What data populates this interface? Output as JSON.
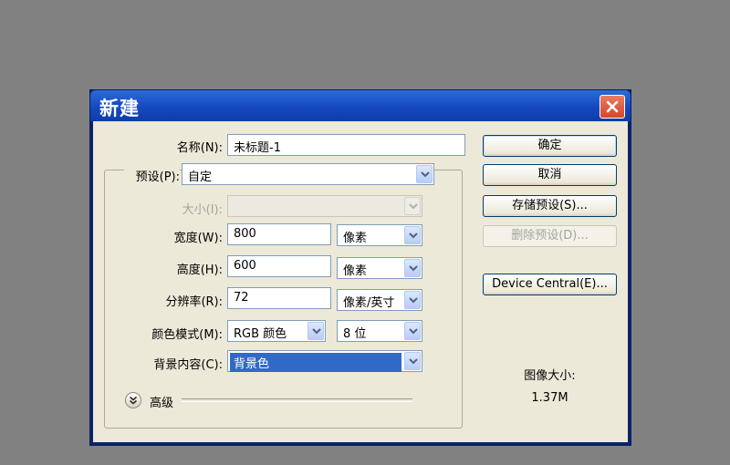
{
  "dialog": {
    "title": "新建",
    "close_icon": "close-icon"
  },
  "form": {
    "name_label": "名称(N):",
    "name_value": "未标题-1",
    "preset_label": "预设(P):",
    "preset_value": "自定",
    "size_label": "大小(I):",
    "size_value": "",
    "width_label": "宽度(W):",
    "width_value": "800",
    "width_unit": "像素",
    "height_label": "高度(H):",
    "height_value": "600",
    "height_unit": "像素",
    "resolution_label": "分辨率(R):",
    "resolution_value": "72",
    "resolution_unit": "像素/英寸",
    "color_mode_label": "颜色模式(M):",
    "color_mode_value": "RGB 颜色",
    "bit_depth_value": "8 位",
    "background_label": "背景内容(C):",
    "background_value": "背景色",
    "advanced_label": "高级"
  },
  "buttons": {
    "ok": "确定",
    "cancel": "取消",
    "save_preset": "存储预设(S)...",
    "delete_preset": "删除预设(D)...",
    "device_central": "Device Central(E)..."
  },
  "info": {
    "image_size_label": "图像大小:",
    "image_size_value": "1.37M"
  },
  "colors": {
    "desktop": "#818181",
    "title_bar": "#1648be",
    "dialog_face": "#ece9d8",
    "selection": "#316ac5",
    "close_button": "#d3472b"
  }
}
